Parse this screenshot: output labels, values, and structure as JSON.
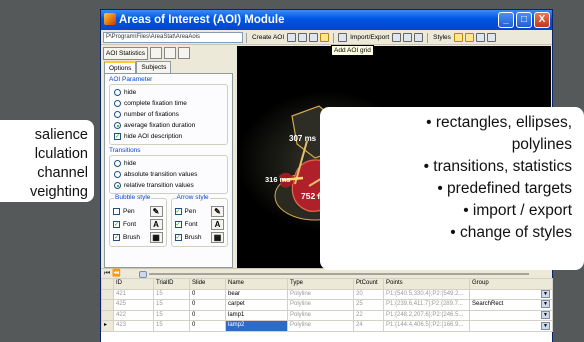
{
  "left_callout": {
    "lines": [
      "salience",
      "lculation",
      "channel",
      "veighting"
    ]
  },
  "window": {
    "title": "Areas of Interest (AOI) Module",
    "buttons": [
      "_",
      "□",
      "X"
    ]
  },
  "toolbar": {
    "path": "P\\Program\\Files\\AreaStat\\AreaAois",
    "create_aoi": "Create AOI",
    "import_export": "Import/Export",
    "styles": "Styles",
    "tooltip": "Add AOI grid"
  },
  "leftpanel": {
    "aoi_stats": "AOI Statistics",
    "tabs": [
      "Options",
      "Subjects"
    ],
    "aoi_parameter": {
      "title": "AOI Parameter",
      "options": [
        {
          "label": "hide",
          "selected": false
        },
        {
          "label": "complete fixation time",
          "selected": false
        },
        {
          "label": "number of fixations",
          "selected": false
        },
        {
          "label": "average fixation duration",
          "selected": true
        }
      ],
      "checkbox": {
        "label": "hide AOI description",
        "checked": true
      }
    },
    "transitions": {
      "title": "Transitions",
      "options": [
        {
          "label": "hide",
          "selected": false
        },
        {
          "label": "absolute transition values",
          "selected": false
        },
        {
          "label": "relative transition values",
          "selected": true
        }
      ]
    },
    "bubble_style": {
      "title": "Bubble style",
      "rows": [
        "Pen",
        "Font",
        "Brush"
      ]
    },
    "arrow_style": {
      "title": "Arrow style",
      "rows": [
        "Pen",
        "Font",
        "Brush"
      ]
    },
    "font_glyph": "A"
  },
  "image": {
    "labels": [
      {
        "text": "307 ms",
        "key": "a"
      },
      {
        "text": "316 ms",
        "key": "b"
      },
      {
        "text": "752 ms",
        "key": "c"
      }
    ]
  },
  "grid": {
    "columns": [
      "ID",
      "TrialID",
      "Slide",
      "Name",
      "Type",
      "PtCount",
      "Points",
      "Group"
    ],
    "rows": [
      {
        "id": "421",
        "trial": "15",
        "slide": "0",
        "name": "bear",
        "type": "Polyline",
        "ptcount": "20",
        "points": "P1:{540.5,330.4};P2:{549.2...",
        "group": "",
        "marker": ""
      },
      {
        "id": "425",
        "trial": "15",
        "slide": "0",
        "name": "carpet",
        "type": "Polyline",
        "ptcount": "25",
        "points": "P1:{239.6,411.7};P2:{289.7...",
        "group": "SearchRect",
        "marker": ""
      },
      {
        "id": "422",
        "trial": "15",
        "slide": "0",
        "name": "lamp1",
        "type": "Polyline",
        "ptcount": "22",
        "points": "P1:{248.2,207.6};P2:{246.5...",
        "group": "",
        "marker": ""
      },
      {
        "id": "423",
        "trial": "15",
        "slide": "0",
        "name": "lamp2",
        "type": "Polyline",
        "ptcount": "24",
        "points": "P1:{144.4,406.5};P2:{166.9...",
        "group": "",
        "marker": "▸"
      }
    ]
  },
  "callout": {
    "lines": [
      "• rectangles, ellipses,",
      "polylines",
      "• transitions, statistics",
      "• predefined targets",
      "• import / export",
      "• change of styles"
    ]
  }
}
